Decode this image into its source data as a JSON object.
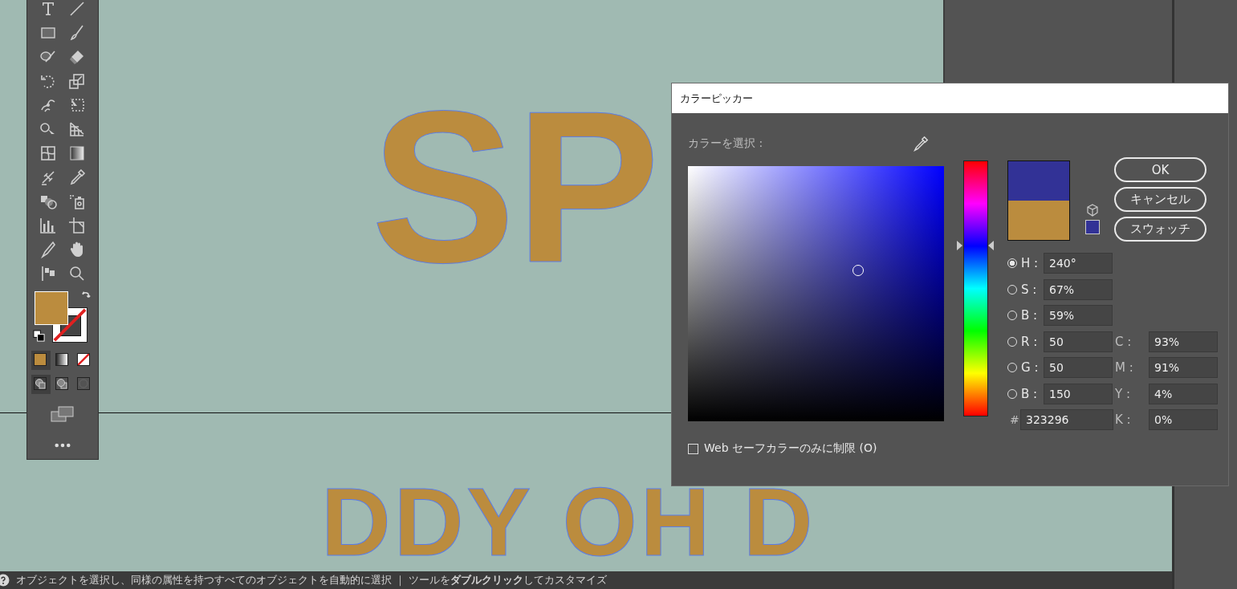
{
  "canvas": {
    "artwork_texts": [
      "SP",
      "DDY OH D"
    ]
  },
  "color_picker": {
    "title": "カラーピッカー",
    "select_label": "カラーを選択 :",
    "hue_slider": {
      "level": 0.667
    },
    "buttons": [
      "OK",
      "キャンセル",
      "スウォッチ"
    ],
    "model_fields": [
      {
        "label": "H :",
        "value": "240°",
        "selected": true
      },
      {
        "label": "S :",
        "value": "67%",
        "selected": false
      },
      {
        "label": "B :",
        "value": "59%",
        "selected": false
      },
      {
        "label": "R :",
        "value": "50",
        "selected": false
      },
      {
        "label": "G :",
        "value": "50",
        "selected": false
      },
      {
        "label": "B :",
        "value": "150",
        "selected": false
      }
    ],
    "hex_field": {
      "label": "#",
      "value": "323296"
    },
    "cmyk_fields": [
      {
        "label": "C :",
        "value": "93%"
      },
      {
        "label": "M :",
        "value": "91%"
      },
      {
        "label": "Y :",
        "value": "4%"
      },
      {
        "label": "K :",
        "value": "0%"
      }
    ],
    "web_safe_checkbox": {
      "label": "Web セーフカラーのみに制限 (O)",
      "checked": false
    }
  },
  "status_bar": {
    "text": "オブジェクトを選択し、同様の属性を持つすべてのオブジェクトを自動的に選択 ｜ ツールを**ダブルクリック**してカスタマイズ"
  }
}
